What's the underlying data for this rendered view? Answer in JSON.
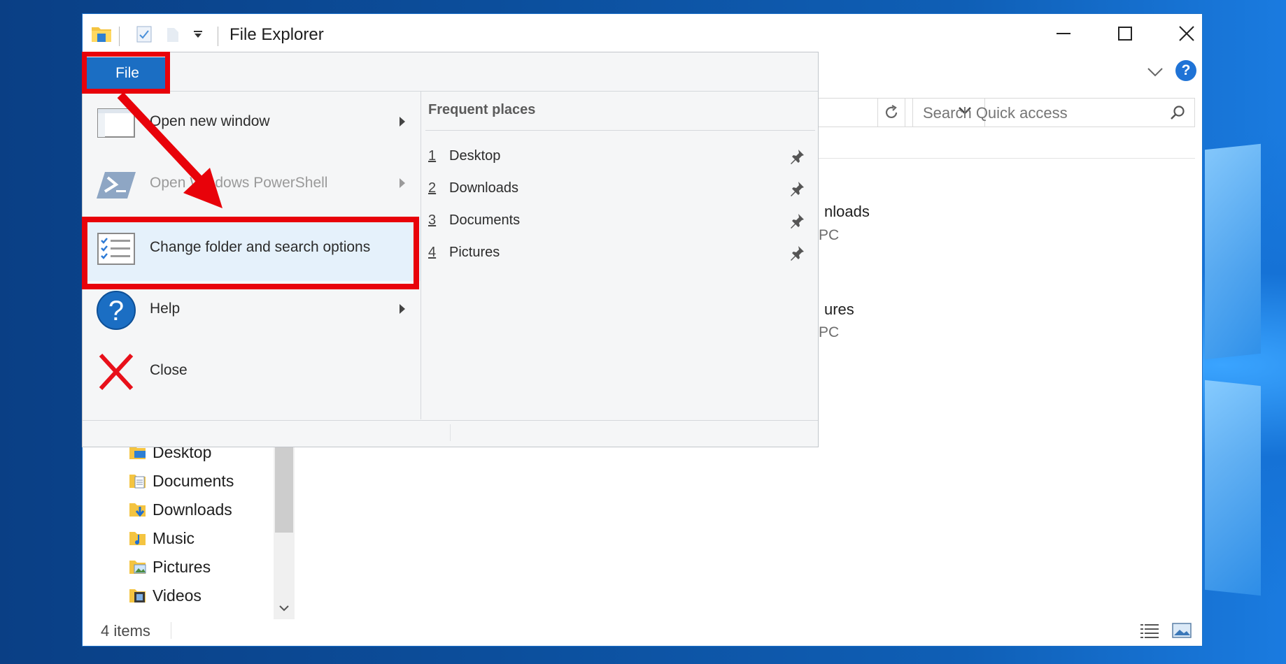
{
  "window": {
    "title": "File Explorer",
    "search_placeholder": "Search Quick access"
  },
  "file_tab": {
    "label": "File"
  },
  "file_menu": {
    "items": [
      {
        "label": "Open new window",
        "has_submenu": true,
        "enabled": true
      },
      {
        "label": "Open Windows PowerShell",
        "has_submenu": true,
        "enabled": false
      },
      {
        "label": "Change folder and search options",
        "has_submenu": false,
        "enabled": true,
        "highlighted": true
      },
      {
        "label": "Help",
        "has_submenu": true,
        "enabled": true
      },
      {
        "label": "Close",
        "has_submenu": false,
        "enabled": true
      }
    ],
    "frequent_places": {
      "header": "Frequent places",
      "items": [
        {
          "num": "1",
          "name": "Desktop"
        },
        {
          "num": "2",
          "name": "Downloads"
        },
        {
          "num": "3",
          "name": "Documents"
        },
        {
          "num": "4",
          "name": "Pictures"
        }
      ]
    }
  },
  "content_partial": {
    "item1_name": "nloads",
    "item1_sub": "PC",
    "item2_name": "ures",
    "item2_sub": "PC"
  },
  "nav_pane": {
    "items": [
      "Desktop",
      "Documents",
      "Downloads",
      "Music",
      "Pictures",
      "Videos"
    ]
  },
  "status_bar": {
    "item_count": "4 items"
  },
  "colors": {
    "accent": "#1b6ec3",
    "highlight_red": "#e8020a",
    "menu_bg": "#f5f6f7"
  }
}
